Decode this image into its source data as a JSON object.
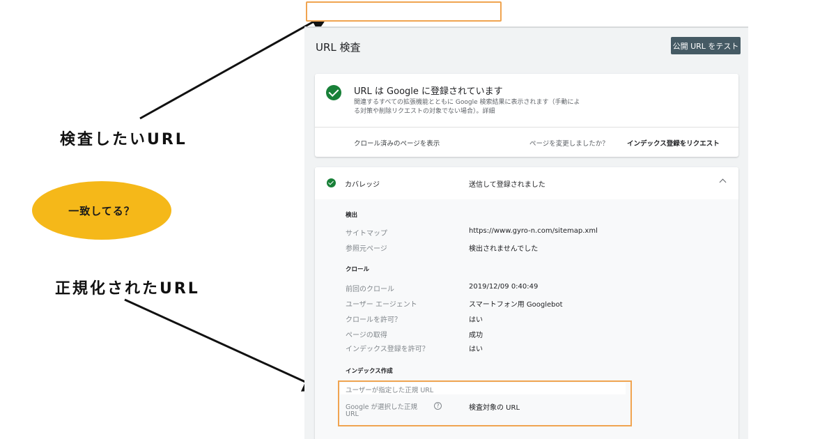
{
  "annotations": {
    "target_url_label": "検査したいURL",
    "match_bubble": "一致してる？",
    "canonical_label": "正規化されたURL"
  },
  "colors": {
    "highlight_border": "#f0a450",
    "bubble": "#f5b819",
    "success_green": "#188038",
    "button_bg": "#455a64"
  },
  "search": {
    "value": ""
  },
  "header": {
    "title": "URL 検査",
    "test_button": "公開 URL をテスト"
  },
  "status_card": {
    "icon": "check-circle-icon",
    "title": "URL は Google に登録されています",
    "desc_line1": "関連するすべての拡張機能とともに Google 検索結果に表示されます（手動によ",
    "desc_line2": "る対策や削除リクエストの対象でない場合）。詳細",
    "view_crawled": "クロール済みのページを表示",
    "changed_question": "ページを変更しましたか？",
    "request_indexing": "インデックス登録をリクエスト"
  },
  "coverage": {
    "label": "カバレッジ",
    "value": "送信して登録されました",
    "sections": {
      "discovery": {
        "title": "検出",
        "rows": [
          {
            "label": "サイトマップ",
            "value": "https://www.gyro-n.com/sitemap.xml"
          },
          {
            "label": "参照元ページ",
            "value": "検出されませんでした"
          }
        ]
      },
      "crawl": {
        "title": "クロール",
        "rows": [
          {
            "label": "前回のクロール",
            "value": "2019/12/09 0:40:49"
          },
          {
            "label": "ユーザー エージェント",
            "value": "スマートフォン用 Googlebot"
          },
          {
            "label": "クロールを許可？",
            "value": "はい"
          },
          {
            "label": "ページの取得",
            "value": "成功"
          },
          {
            "label": "インデックス登録を許可？",
            "value": "はい"
          }
        ]
      },
      "indexing": {
        "title": "インデックス作成",
        "user_canonical_label": "ユーザーが指定した正規 URL",
        "user_canonical_value": "",
        "google_canonical_label_1": "Google が選択した正規",
        "google_canonical_label_2": "URL",
        "help_glyph": "?",
        "google_canonical_value": "検査対象の URL"
      }
    }
  }
}
